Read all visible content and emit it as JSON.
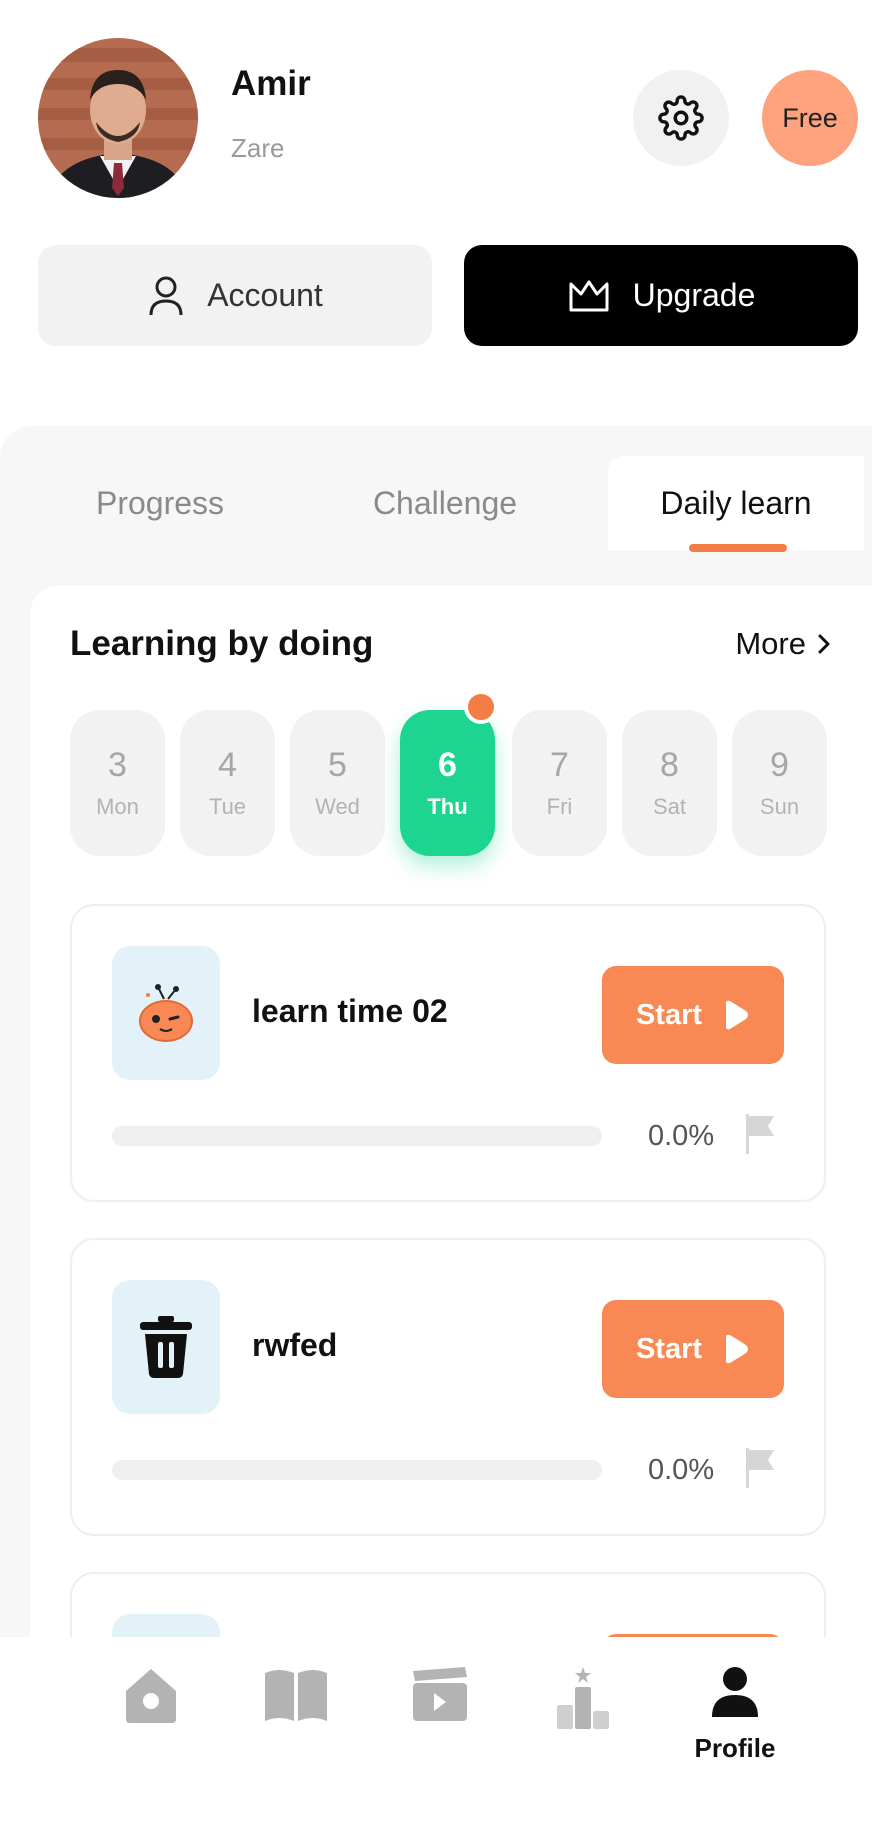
{
  "profile": {
    "name": "Amir",
    "subtitle": "Zare",
    "plan": "Free"
  },
  "actions": {
    "account_label": "Account",
    "upgrade_label": "Upgrade"
  },
  "tabs": [
    {
      "label": "Progress",
      "active": false
    },
    {
      "label": "Challenge",
      "active": false
    },
    {
      "label": "Daily learn",
      "active": true
    }
  ],
  "section": {
    "title": "Learning by doing",
    "more_label": "More"
  },
  "days": [
    {
      "num": "3",
      "name": "Mon",
      "active": false
    },
    {
      "num": "4",
      "name": "Tue",
      "active": false
    },
    {
      "num": "5",
      "name": "Wed",
      "active": false
    },
    {
      "num": "6",
      "name": "Thu",
      "active": true
    },
    {
      "num": "7",
      "name": "Fri",
      "active": false
    },
    {
      "num": "8",
      "name": "Sat",
      "active": false
    },
    {
      "num": "9",
      "name": "Sun",
      "active": false
    }
  ],
  "lessons": [
    {
      "title": "learn time 02",
      "start_label": "Start",
      "progress": 0.0,
      "progress_text": "0.0%",
      "icon": "robot-icon"
    },
    {
      "title": "rwfed",
      "start_label": "Start",
      "progress": 0.0,
      "progress_text": "0.0%",
      "icon": "trash-icon"
    }
  ],
  "nav": {
    "items": [
      "home-icon",
      "book-icon",
      "video-icon",
      "leaderboard-icon",
      "profile-icon"
    ],
    "active_label": "Profile"
  },
  "colors": {
    "accent": "#f98954",
    "active_day": "#1ed491",
    "plan_badge": "#fea27d"
  }
}
